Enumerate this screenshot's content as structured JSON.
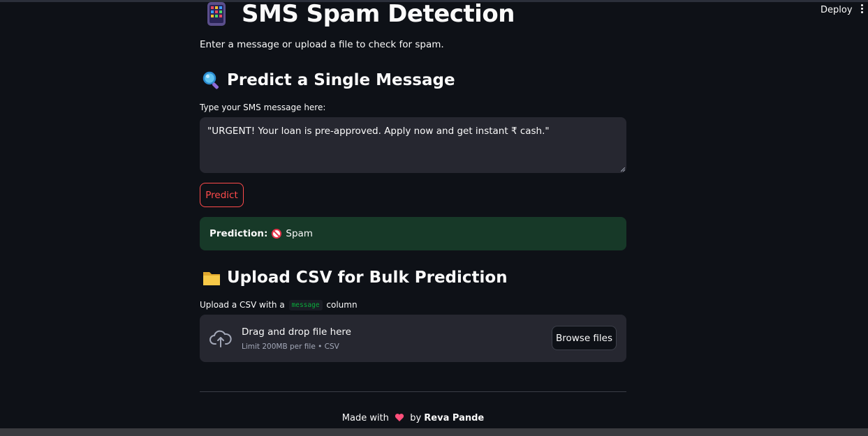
{
  "header": {
    "deploy_label": "Deploy",
    "menu_icon": "kebab-menu-icon"
  },
  "page": {
    "title": "SMS Spam Detection",
    "title_icon": "mobile-phone-icon",
    "subtitle": "Enter a message or upload a file to check for spam."
  },
  "single": {
    "heading": "Predict a Single Message",
    "heading_icon": "magnifier-icon",
    "input_label": "Type your SMS message here:",
    "message_value": "\"URGENT! Your loan is pre-approved. Apply now and get instant ₹ cash.\"",
    "predict_label": "Predict"
  },
  "result": {
    "prefix": "Prediction:",
    "icon": "prohibited-icon",
    "value": "Spam",
    "background": "#173928"
  },
  "bulk": {
    "heading": "Upload CSV for Bulk Prediction",
    "heading_icon": "folder-icon",
    "label_before": "Upload a CSV with a",
    "label_code": "message",
    "label_after": "column",
    "drop_title": "Drag and drop file here",
    "drop_hint": "Limit 200MB per file • CSV",
    "browse_label": "Browse files",
    "upload_icon": "cloud-upload-icon"
  },
  "footer": {
    "made_with": "Made with",
    "heart_icon": "heart-icon",
    "by": "by",
    "author": "Reva Pande"
  },
  "colors": {
    "background": "#0e1117",
    "accent": "#ff4b4b",
    "input_bg": "#262730",
    "success_bg": "#173928",
    "code_text": "#09ab3b"
  }
}
